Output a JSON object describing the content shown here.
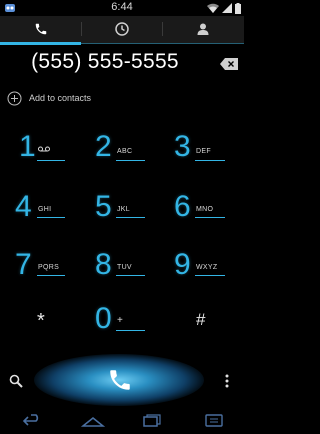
{
  "status_bar": {
    "time": "6:44"
  },
  "tabs": [
    {
      "label": "",
      "icon": "phone-icon",
      "active": true
    },
    {
      "label": "",
      "icon": "clock-icon",
      "active": false
    },
    {
      "label": "",
      "icon": "person-icon",
      "active": false
    }
  ],
  "dialer": {
    "number": "(555) 555-5555",
    "add_to_contacts": "Add to contacts"
  },
  "keypad": [
    {
      "digit": "1",
      "letters": ""
    },
    {
      "digit": "2",
      "letters": "ABC"
    },
    {
      "digit": "3",
      "letters": "DEF"
    },
    {
      "digit": "4",
      "letters": "GHI"
    },
    {
      "digit": "5",
      "letters": "JKL"
    },
    {
      "digit": "6",
      "letters": "MNO"
    },
    {
      "digit": "7",
      "letters": "PQRS"
    },
    {
      "digit": "8",
      "letters": "TUV"
    },
    {
      "digit": "9",
      "letters": "WXYZ"
    },
    {
      "digit": "*",
      "letters": ""
    },
    {
      "digit": "0",
      "letters": "+"
    },
    {
      "digit": "#",
      "letters": ""
    }
  ],
  "colors": {
    "accent": "#33b5e5",
    "background": "#000000"
  }
}
